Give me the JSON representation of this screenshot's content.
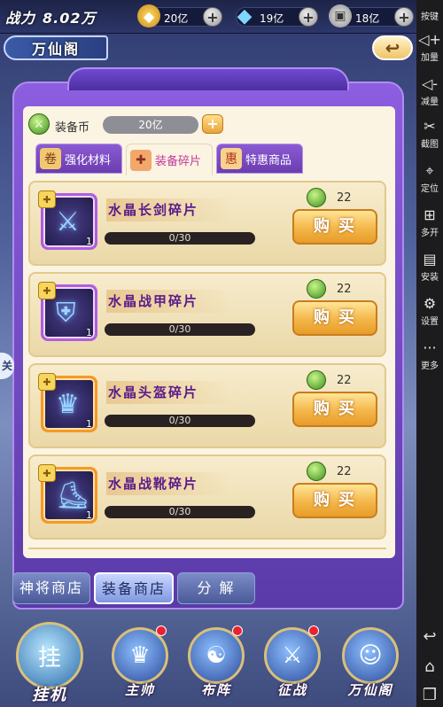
{
  "top_bar": {
    "power_label": "战力",
    "power_value": "8.02万",
    "gold": "20亿",
    "diamond": "19亿",
    "coin": "18亿",
    "plus": "+"
  },
  "title": {
    "text": "万仙阁",
    "back_icon": "back-arrow-icon"
  },
  "shop": {
    "currency_label": "装备币",
    "currency_value": "20亿",
    "add": "+",
    "tabs": [
      {
        "label": "强化材料",
        "icon": "scroll-icon",
        "active": false
      },
      {
        "label": "装备碎片",
        "icon": "puzzle-icon",
        "active": true
      },
      {
        "label": "特惠商品",
        "icon": "gift-icon",
        "active": false
      }
    ],
    "items": [
      {
        "name": "水晶长剑碎片",
        "progress": "0/30",
        "owned": "1",
        "price": "22",
        "buy": "购买",
        "icon": "crystal-sword-icon"
      },
      {
        "name": "水晶战甲碎片",
        "progress": "0/30",
        "owned": "1",
        "price": "22",
        "buy": "购买",
        "icon": "crystal-armor-icon"
      },
      {
        "name": "水晶头盔碎片",
        "progress": "0/30",
        "owned": "1",
        "price": "22",
        "buy": "购买",
        "icon": "crystal-helmet-icon"
      },
      {
        "name": "水晶战靴碎片",
        "progress": "0/30",
        "owned": "1",
        "price": "22",
        "buy": "购买",
        "icon": "crystal-boots-icon"
      }
    ],
    "sub_tabs": [
      {
        "label": "神将商店",
        "active": false
      },
      {
        "label": "装备商店",
        "active": true
      },
      {
        "label": "分 解",
        "active": false
      }
    ]
  },
  "bottom_nav": [
    {
      "label": "挂机",
      "badge": "挂",
      "icon": "idle-hero-icon"
    },
    {
      "label": "主帅",
      "icon": "commander-icon"
    },
    {
      "label": "布阵",
      "icon": "formation-icon"
    },
    {
      "label": "征战",
      "icon": "battle-icon"
    },
    {
      "label": "万仙阁",
      "icon": "immortal-pavilion-icon"
    }
  ],
  "edge_badge": "关",
  "sidebar": [
    {
      "label": "按键",
      "icon": "keyboard-icon"
    },
    {
      "label": "加量",
      "icon": "volume-up-icon"
    },
    {
      "label": "减量",
      "icon": "volume-down-icon"
    },
    {
      "label": "截图",
      "icon": "scissors-icon"
    },
    {
      "label": "定位",
      "icon": "location-icon"
    },
    {
      "label": "多开",
      "icon": "multi-instance-icon"
    },
    {
      "label": "安装",
      "icon": "apk-install-icon"
    },
    {
      "label": "设置",
      "icon": "settings-icon"
    },
    {
      "label": "更多",
      "icon": "more-icon"
    }
  ],
  "colors": {
    "accent_purple": "#8b5ad4",
    "buy_button": "#f4b649",
    "item_name": "#5a1a8a"
  }
}
